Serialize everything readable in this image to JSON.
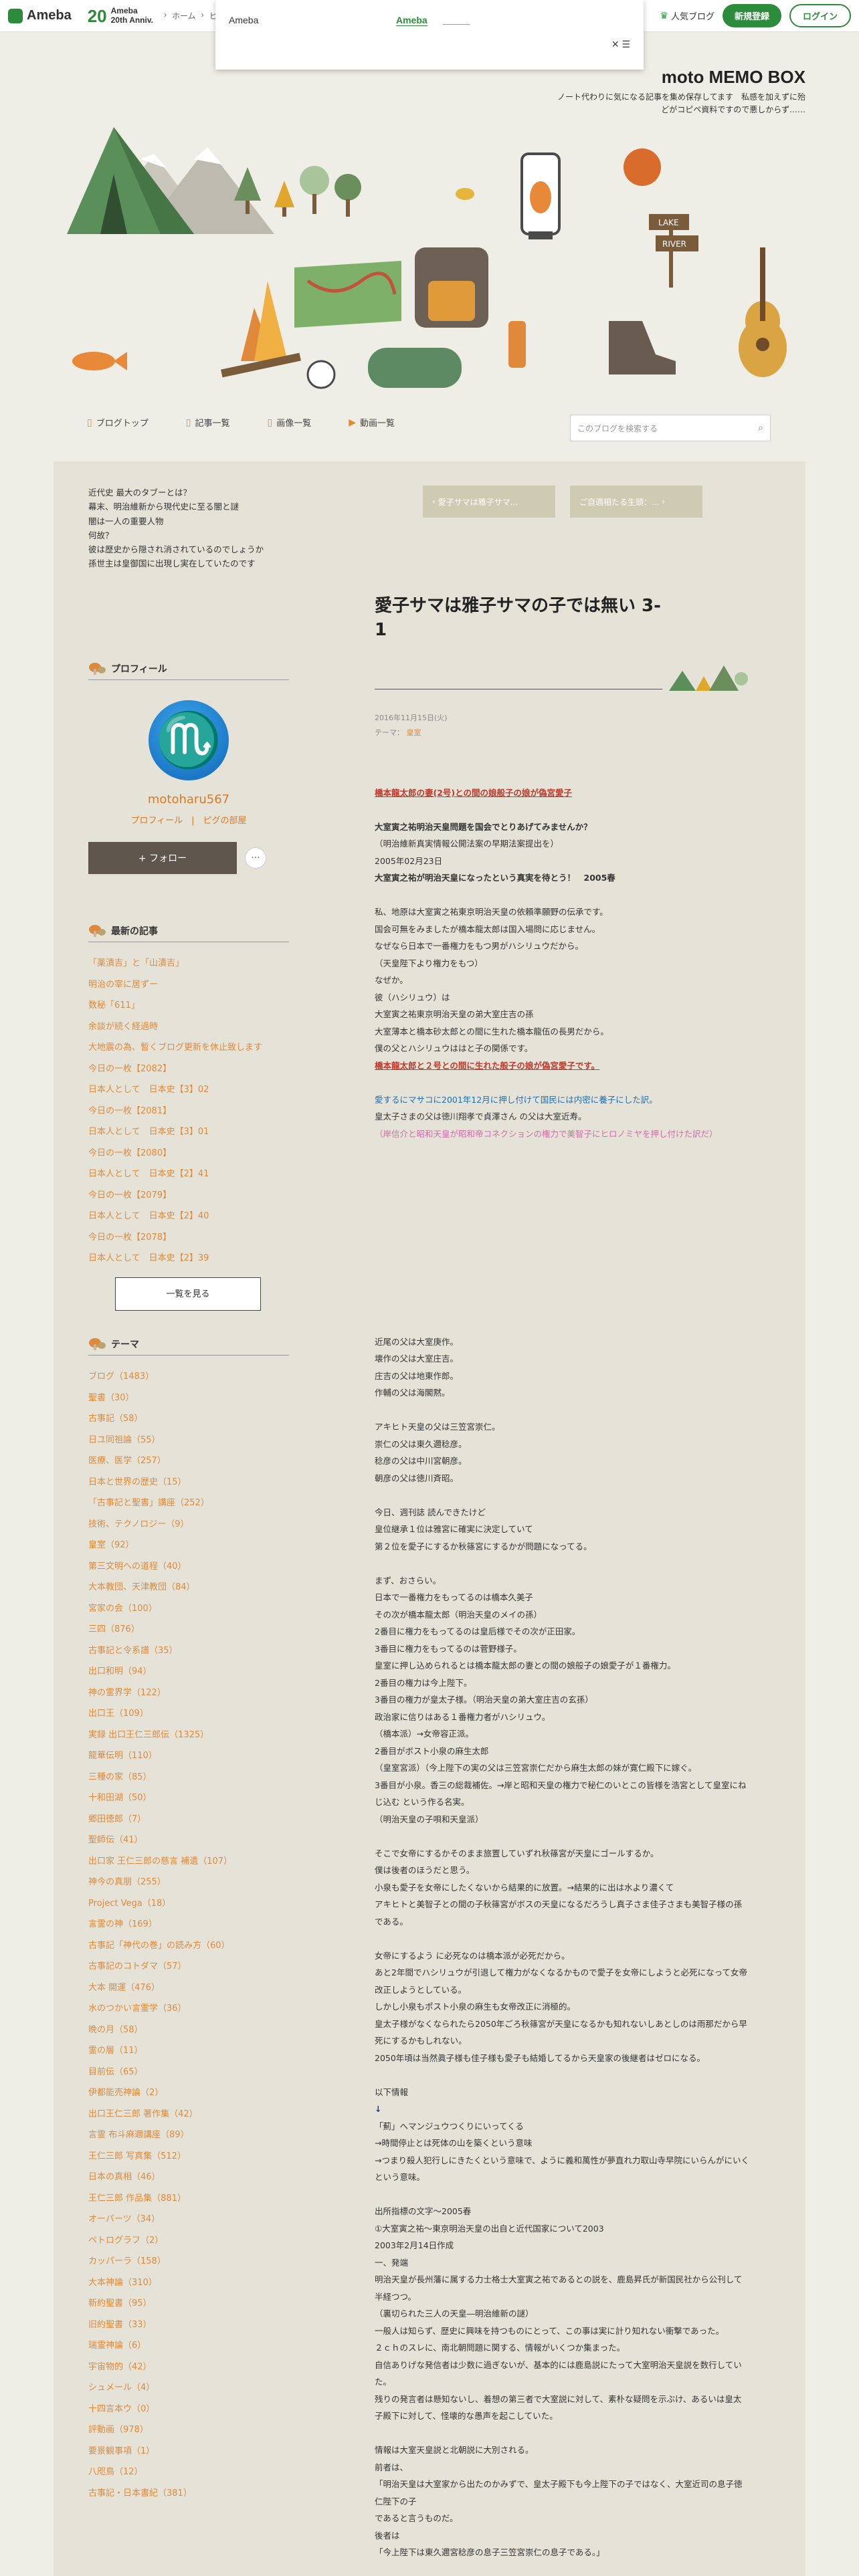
{
  "topbar": {
    "logo": "Ameba",
    "anniv_num": "20",
    "anniv_line1": "Ameba",
    "anniv_line2": "20th Anniv.",
    "breadcrumb": [
      "ホーム",
      "ヒ"
    ],
    "popular": "人気ブログ",
    "signup": "新規登録",
    "login": "ログイン"
  },
  "popup": {
    "title": "Ameba",
    "brand": "Ameba",
    "close": "✕ ☰"
  },
  "header": {
    "blog_title": "moto MEMO BOX",
    "blog_desc": "ノート代わりに気になる記事を集め保存してます　私感を加えずに殆どがコピペ資料ですので悪しからず……",
    "banner_signs": [
      "LAKE",
      "RIVER"
    ]
  },
  "nav": {
    "items": [
      "ブログトップ",
      "記事一覧",
      "画像一覧",
      "動画一覧"
    ],
    "search_placeholder": "このブログを検索する"
  },
  "sidebar": {
    "intro": [
      "近代史 最大のタブーとは？",
      "幕末、明治維新から現代史に至る闇と謎",
      "闇は一人の重要人物",
      "何故？",
      "彼は歴史から隠され消されているのでしょうか",
      "孫世主は皇御国に出現し実在していたのです"
    ],
    "profile_heading": "プロフィール",
    "username": "motoharu567",
    "profile_links": "プロフィール　|　ピグの部屋",
    "follow": "+ フォロー",
    "more": "···",
    "recent_heading": "最新の記事",
    "recent": [
      "「薬漬吉」と「山漬吉」",
      "明治の宰に居ずー",
      "数秘「611」",
      "余談が続く経過時",
      "大地震の為、暫くブログ更新を休止致します",
      "今日の一枚【2082】",
      "日本人として　日本史【3】02",
      "今日の一枚【2081】",
      "日本人として　日本史【3】01",
      "今日の一枚【2080】",
      "日本人として　日本史【2】41",
      "今日の一枚【2079】",
      "日本人として　日本史【2】40",
      "今日の一枚【2078】",
      "日本人として　日本史【2】39"
    ],
    "view_all": "一覧を見る",
    "theme_heading": "テーマ",
    "themes": [
      "ブログ（1483）",
      "聖書（30）",
      "古事記（58）",
      "日ユ同祖論（55）",
      "医療、医学（257）",
      "日本と世界の歴史（15）",
      "「古事記と聖書」講座（252）",
      "技術、テクノロジー（9）",
      "皇室（92）",
      "第三文明への道程（40）",
      "大本教団、天津教団（84）",
      "宮家の会（100）",
      "三四（876）",
      "古事記と令系譜（35）",
      "出口和明（94）",
      "神の霊界学（122）",
      "出口王（109）",
      "実録 出口王仁三郎伝（1325）",
      "龍華伝明（110）",
      "三種の家（85）",
      "十和田湖（50）",
      "郷田徳郎（7）",
      "聖師伝（41）",
      "出口家 王仁三郎の慈言 補遺（107）",
      "神今の真朋（255）",
      "Project Vega（18）",
      "言霊の神（169）",
      "古事記「神代の巻」の読み方（60）",
      "古事記のコトダマ（57）",
      "大本 開運（476）",
      "水のつかい言霊学（36）",
      "晩の月（58）",
      "霊の層（11）",
      "目前伝（65）",
      "伊都能売神論（2）",
      "出口王仁三郎 著作集（42）",
      "言霊 布斗麻邇講座（89）",
      "王仁三郎 写真集（512）",
      "日本の真相（46）",
      "王仁三郎 作品集（881）",
      "オーパーツ（34）",
      "ペトログラフ（2）",
      "カッパーラ（158）",
      "大本神論（310）",
      "新約聖書（95）",
      "旧約聖書（33）",
      "瑞霊神論（6）",
      "宇宙物的（42）",
      "シュメール（4）",
      "十四言本ウ（0）",
      "評動画（978）",
      "要景観事項（1）",
      "八咫鳥（12）",
      "古事記・日本書紀（381）"
    ]
  },
  "post": {
    "prev": "愛子サマは雅子サマ...",
    "next": "ご自適相たる生頭：...",
    "title": "愛子サマは雅子サマの子では無い 3-1",
    "date": "2016年11月15日(火)",
    "theme_label": "テーマ：",
    "theme": "皇室",
    "body": [
      "橋本龍太郎の妻(2号)との間の娘般子の娘が偽宮愛子",
      "",
      "大室寅之祐明治天皇問題を国会でとりあげてみませんか？",
      "（明治維新真実情報公開法案の早期法案提出を）",
      "2005年02月23日",
      "大室寅之祐が明治天皇になったという真実を待とう！　2005春",
      "",
      "私、地原は大室寅之祐東京明治天皇の依頼準願野の伝承です。",
      "国会可無をみましたが橋本龍太郎は国入場問に応じません。",
      "なぜなら日本で一番権力をもつ男がハシリュウだから。",
      "（天皇陛下より権力をもつ）",
      "なぜか。",
      "彼（ハシリュウ）は",
      "大室寅之祐東京明治天皇の弟大室庄吉の孫",
      "大室薄本と橋本砂太郎との間に生れた橋本龍伍の長男だから。",
      "僕の父とハシリュウははと子の関係です。",
      "橋本龍太郎と２号との間に生れた般子の娘が偽宮愛子です。",
      "",
      "愛するにマサコに2001年12月に押し付けて国民には内密に養子にした訳。",
      "皇太子さまの父は徳川翔孝で貞澤さん の父は大室近寿。",
      "（岸信介と昭和天皇が昭和帝コネクションの権力で美智子にヒロノミヤを押し付けた訳だ）",
      "",
      "近尾の父は大室庚作。",
      "壊作の父は大室庄吉。",
      "庄吉の父は地東作郎。",
      "作輔の父は海閣黙。",
      "",
      "アキヒト天皇の父は三笠宮崇仁。",
      "崇仁の父は東久邇稔彦。",
      "稔彦の父は中川宮朝彦。",
      "朝彦の父は徳川斉昭。",
      "",
      "今日、週刊誌 読んできたけど",
      "皇位継承１位は雅宮に確実に決定していて",
      "第２位を愛子にするか秋篠宮にするかが問題になってる。",
      "",
      "まず、おさらい。",
      "日本で一番権力をもってるのは橋本久美子",
      "その次が橋本龍太郎（明治天皇のメイの孫）",
      "2番目に権力をもってるのは皇后様でその次が正田家。",
      "3番目に権力をもってるのは菅野様子。",
      "皇室に押し込められるとは橋本龍太郎の妻との間の娘般子の娘愛子が１番権力。",
      "2番目の権力は今上陛下。",
      "3番目の権力が皇太子様。（明治天皇の弟大室庄吉の玄孫）",
      "政治家に信りはある１番権力者がハシリュウ。",
      "（橋本派）→女帝容正派。",
      "2番目がボスト小泉の麻生太郎",
      "（皇室宮派）（今上陛下の実の父は三笠宮崇仁だから麻生太郎の妹が寛仁殿下に嫁ぐ。",
      "3番目が小泉。香三の総裁補佐。→岸と昭和天皇の権力で秘仁のいとこの皆様を浩宮として皇室にねじ込む という作る名実。",
      "（明治天皇の子唄和天皇派）",
      "",
      "そこで女帝にするかそのまま旅置していずれ秋篠宮が天皇にゴールするか。",
      "僕は後者のほうだと思う。",
      "小泉も愛子を女帝にしたくないから結果的に放置。→結果的に出は水より濃くて",
      "アキヒトと美智子との間の子秋篠宮がボスの天皇になるだろうし真子さま佳子さまも美智子様の孫である。",
      "",
      "女帝にするよう に必死なのは橋本派が必死だから。",
      "あと2年間でハシリュウが引退して権力がなくなるかもので愛子を女帝にしようと必死になって女帝改正しようとしている。",
      "しかし小泉もポスト小泉の麻生も女帝改正に消極的。",
      "皇太子様がなくなられたら2050年ごろ秋篠宮が天皇になるかも知れないしあとしのは雨那だから早死にするかもしれない。",
      "2050年頃は当然眞子様も佳子様も愛子も結婚してるから天皇家の後継者はゼロになる。",
      "",
      "以下情報",
      "↓",
      "「薊」へマンジュウつくりにいってくる",
      "→時間停止とは死体の山を築くという意味",
      "→つまり殺人犯行しにきたくという意味で、ように義和萬性が夢直れ力取山寺早院にいらんがにいくという意味。",
      "",
      "出所指標の文字～2005春",
      "①大室寅之祐～東京明治天皇の出自と近代国家について2003",
      "2003年2月14日作成",
      "一、発端",
      "明治天皇が長州藩に属する力士格士大室寅之祐であるとの説を、鹿島昇氏が新国民社から公刊して半経つつ。",
      "（裏切られた三人の天皇―明治維新の謎）",
      "一般人は知らず、歴史に興味を持つものにとって、この事は実に計り知れない衝撃であった。",
      "２ｃｈのスレに、南北朝問題に関する、情報がいくつか集まった。",
      "自信ありげな発信者は少数に過ぎないが、基本的には鹿島説にたって大室明治天皇説を数行していた。",
      "残りの発言者は懸知ないし、着想の第三者で大室説に対して、素朴な疑問を示ぶけ、あるいは皇太子殿下に対して、怪壊的な愚声を起こしていた。",
      "",
      "情報は大室天皇説と北朝説に大別される。",
      "前者は、",
      "「明治天皇は大室家から出たのかみずで、皇太子殿下も今上陛下の子ではなく、大室近司の息子徳仁陛下の子",
      "であると言うものだ。",
      "後者は",
      "「今上陛下は東久邇宮稔彦の息子三笠宮崇仁の息子である。」"
    ]
  }
}
